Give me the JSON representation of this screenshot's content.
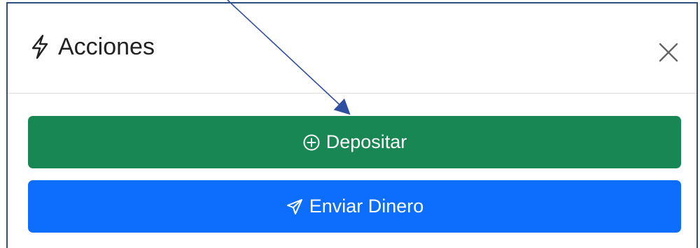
{
  "panel": {
    "title": "Acciones",
    "title_icon": "lightning-bolt-icon",
    "close_icon": "close-icon"
  },
  "actions": [
    {
      "label": "Depositar",
      "icon": "plus-circle-icon",
      "color": "#198754"
    },
    {
      "label": "Enviar Dinero",
      "icon": "paper-plane-icon",
      "color": "#0d6efd"
    }
  ],
  "colors": {
    "annotation_arrow": "#2f4f9f",
    "border": "#2f4f7f"
  }
}
